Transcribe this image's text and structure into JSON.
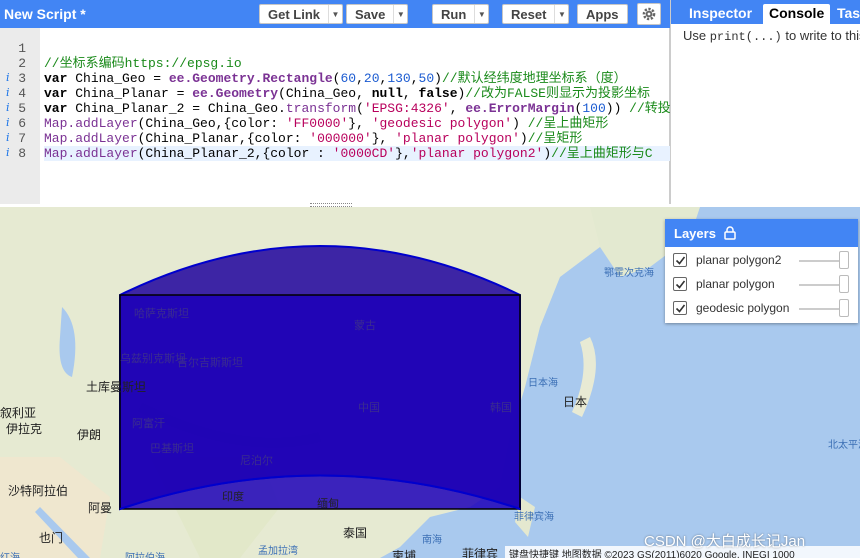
{
  "toolbar": {
    "script_title": "New Script *",
    "get_link": "Get Link",
    "save": "Save",
    "run": "Run",
    "reset": "Reset",
    "apps": "Apps"
  },
  "right_panel": {
    "tabs": [
      "Inspector",
      "Console",
      "Tasks"
    ],
    "active_tab": "Console",
    "console_hint_pre": "Use ",
    "console_hint_code": "print(...)",
    "console_hint_post": " to write to this console."
  },
  "editor": {
    "line_numbers": [
      "1",
      "2",
      "3",
      "4",
      "5",
      "6",
      "7",
      "8"
    ],
    "info_lines": [
      3,
      4,
      5,
      6,
      7,
      8
    ],
    "active_line": 8,
    "lines": [
      [
        [
          "",
          "t"
        ]
      ],
      [
        [
          "//坐标系编码https://epsg.io",
          "c"
        ]
      ],
      [
        [
          "var ",
          "k"
        ],
        [
          "China_Geo = ",
          "t"
        ],
        [
          "ee.Geometry.Rectangle",
          "ee"
        ],
        [
          "(",
          "t"
        ],
        [
          "60",
          "n"
        ],
        [
          ",",
          "t"
        ],
        [
          "20",
          "n"
        ],
        [
          ",",
          "t"
        ],
        [
          "130",
          "n"
        ],
        [
          ",",
          "t"
        ],
        [
          "50",
          "n"
        ],
        [
          ")",
          "t"
        ],
        [
          "//默认经纬度地理坐标系（度）",
          "c"
        ]
      ],
      [
        [
          "var ",
          "k"
        ],
        [
          "China_Planar = ",
          "t"
        ],
        [
          "ee.Geometry",
          "ee"
        ],
        [
          "(China_Geo, ",
          "t"
        ],
        [
          "null",
          "k"
        ],
        [
          ", ",
          "t"
        ],
        [
          "false",
          "k"
        ],
        [
          ")",
          "t"
        ],
        [
          "//改为FALSE则显示为投影坐标",
          "c"
        ]
      ],
      [
        [
          "var ",
          "k"
        ],
        [
          "China_Planar_2 = China_Geo.",
          "t"
        ],
        [
          "transform",
          "g"
        ],
        [
          "(",
          "t"
        ],
        [
          "'EPSG:4326'",
          "s"
        ],
        [
          ", ",
          "t"
        ],
        [
          "ee.ErrorMargin",
          "ee"
        ],
        [
          "(",
          "t"
        ],
        [
          "100",
          "n"
        ],
        [
          ")) ",
          "t"
        ],
        [
          "//转投影",
          "c"
        ]
      ],
      [
        [
          "Map.addLayer",
          "g"
        ],
        [
          "(China_Geo,{color: ",
          "t"
        ],
        [
          "'FF0000'",
          "s"
        ],
        [
          "}, ",
          "t"
        ],
        [
          "'geodesic polygon'",
          "s"
        ],
        [
          ") ",
          "t"
        ],
        [
          "//呈上曲矩形",
          "c"
        ]
      ],
      [
        [
          "Map.addLayer",
          "g"
        ],
        [
          "(China_Planar,{color: ",
          "t"
        ],
        [
          "'000000'",
          "s"
        ],
        [
          "}, ",
          "t"
        ],
        [
          "'planar polygon'",
          "s"
        ],
        [
          ")",
          "t"
        ],
        [
          "//呈矩形",
          "c"
        ]
      ],
      [
        [
          "Map.addLayer",
          "g"
        ],
        [
          "(China_Planar_2,{color : ",
          "t"
        ],
        [
          "'0000CD'",
          "s"
        ],
        [
          "},",
          "t"
        ],
        [
          "'planar polygon2'",
          "s"
        ],
        [
          ")",
          "t"
        ],
        [
          "//呈上曲矩形与C",
          "c"
        ]
      ]
    ]
  },
  "layers_panel": {
    "title": "Layers",
    "layers": [
      {
        "name": "planar polygon2",
        "checked": true
      },
      {
        "name": "planar polygon",
        "checked": true
      },
      {
        "name": "geodesic polygon",
        "checked": true
      }
    ]
  },
  "map": {
    "labels": {
      "kazakhstan": "哈萨克斯坦",
      "mongolia": "蒙古",
      "china": "中国",
      "korea": "韩国",
      "japan": "日本",
      "sea_of_japan": "日本海",
      "sea_of_okhotsk": "鄂霍次克海",
      "uzbekistan": "乌兹别克斯坦",
      "kyrgyzstan": "吉尔吉斯斯坦",
      "turkmenistan": "土库曼斯坦",
      "afghanistan": "阿富汗",
      "pakistan": "巴基斯坦",
      "nepal": "尼泊尔",
      "iran": "伊朗",
      "iraq": "伊拉克",
      "syria": "叙利亚",
      "saudi_arabia": "沙特阿拉伯",
      "oman": "阿曼",
      "yemen": "也门",
      "india": "印度",
      "myanmar": "缅甸",
      "thailand": "泰国",
      "philippine_sea": "菲律宾海",
      "south_china_sea": "南海",
      "bengal_bay": "孟加拉湾",
      "arabian_sea": "阿拉伯海",
      "philippines": "菲律宾",
      "north_pacific": "北太平洋",
      "red_sea": "红海",
      "cambodia": "柬埔"
    },
    "attribution": "键盘快捷键  地图数据 ©2023 GS(2011)6020 Google, INEGI  1000",
    "watermark": "CSDN @大白成长记Jan"
  },
  "colors": {
    "toolbar_blue": "#4285f4",
    "polygon_fill": "#2200aa",
    "polygon_stroke": "#0000CD",
    "land": "#e4e8d2",
    "water": "#a9c9ee"
  },
  "icons": {
    "settings": "gear-icon",
    "dropdown": "chevron-down-icon",
    "lock": "lock-icon",
    "checkbox": "checkmark-icon",
    "info": "info-icon"
  }
}
